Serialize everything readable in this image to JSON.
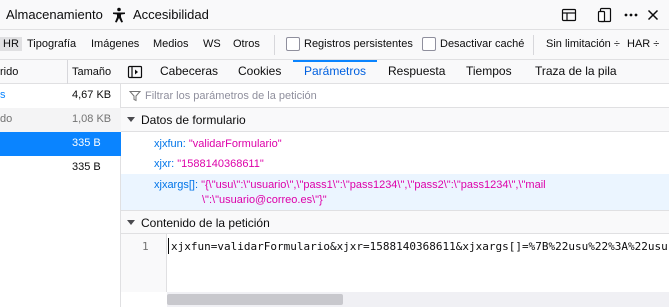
{
  "toolbar": {
    "storage_tab": "Almacenamiento",
    "accessibility_tab": "Accesibilidad",
    "icons": [
      "accessibility-icon",
      "responsive-mode-icon",
      "dock-icon",
      "more-icon",
      "close-icon"
    ]
  },
  "filter_bar": {
    "types": [
      "HR",
      "Tipografía",
      "Imágenes",
      "Medios",
      "WS",
      "Otros"
    ],
    "selected_type": "HR",
    "persistent_logs_label": "Registros persistentes",
    "disable_cache_label": "Desactivar caché",
    "throttling": "Sin limitación",
    "throttling_caret": "÷",
    "har_label": "HAR",
    "har_caret": "÷"
  },
  "request_list": {
    "columns": [
      "rido",
      "Tamaño"
    ],
    "rows": [
      {
        "col1": "s",
        "size": "4,67 KB",
        "state": "normal"
      },
      {
        "col1": "do",
        "size": "1,08 KB",
        "state": "alt"
      },
      {
        "col1": "",
        "size": "335 B",
        "state": "selected"
      },
      {
        "col1": "",
        "size": "335 B",
        "state": "normal"
      }
    ]
  },
  "details": {
    "tabs": [
      "Cabeceras",
      "Cookies",
      "Parámetros",
      "Respuesta",
      "Tiempos",
      "Traza de la pila"
    ],
    "active_tab": "Parámetros",
    "filter_placeholder": "Filtrar los parámetros de la petición",
    "form_data_section": "Datos de formulario",
    "params": [
      {
        "key": "xjxfun:",
        "value": "\"validarFormulario\""
      },
      {
        "key": "xjxr:",
        "value": "\"1588140368611\""
      },
      {
        "key": "xjxargs[]:",
        "value": "\"{\\\"usu\\\":\\\"usuario\\\",\\\"pass1\\\":\\\"pass1234\\\",\\\"pass2\\\":\\\"pass1234\\\",\\\"mail",
        "value_line2": "\\\":\\\"usuario@correo.es\\\"}\""
      }
    ],
    "request_body_section": "Contenido de la petición",
    "line_number": "1",
    "body_text": "xjxfun=validarFormulario&xjxr=1588140368611&xjxargs[]=%7B%22usu%22%3A%22usu"
  }
}
